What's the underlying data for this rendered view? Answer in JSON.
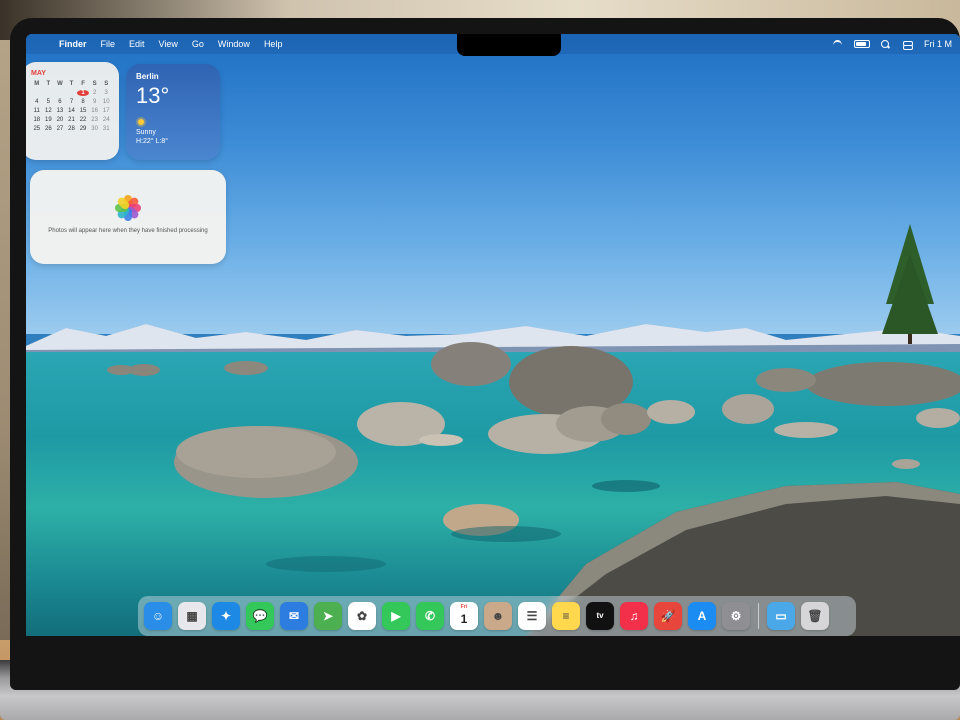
{
  "menubar": {
    "apple_glyph": "",
    "items": [
      "Finder",
      "File",
      "Edit",
      "View",
      "Go",
      "Window",
      "Help"
    ],
    "clock": "Fri 1 M"
  },
  "calendar_widget": {
    "month": "MAY",
    "weekdays": [
      "M",
      "T",
      "W",
      "T",
      "F",
      "S",
      "S"
    ],
    "weeks": [
      [
        "",
        "",
        "",
        "",
        "1",
        "2",
        "3"
      ],
      [
        "4",
        "5",
        "6",
        "7",
        "8",
        "9",
        "10"
      ],
      [
        "11",
        "12",
        "13",
        "14",
        "15",
        "16",
        "17"
      ],
      [
        "18",
        "19",
        "20",
        "21",
        "22",
        "23",
        "24"
      ],
      [
        "25",
        "26",
        "27",
        "28",
        "29",
        "30",
        "31"
      ]
    ],
    "today": "1"
  },
  "weather_widget": {
    "city": "Berlin",
    "temperature": "13°",
    "condition": "Sunny",
    "high_low": "H:22° L:8°",
    "icon": "sun-icon"
  },
  "photos_widget": {
    "message": "Photos will appear here when they have finished processing",
    "icon": "photos-icon"
  },
  "dock": {
    "apps": [
      {
        "name": "finder-app",
        "color": "#2a8ee8",
        "glyph": "☺"
      },
      {
        "name": "launchpad-app",
        "color": "#e8e8ec",
        "glyph": "▦"
      },
      {
        "name": "safari-app",
        "color": "#1e88e5",
        "glyph": "✦"
      },
      {
        "name": "messages-app",
        "color": "#34c759",
        "glyph": "💬"
      },
      {
        "name": "mail-app",
        "color": "#2d7ce0",
        "glyph": "✉"
      },
      {
        "name": "maps-app",
        "color": "#4caf50",
        "glyph": "➤"
      },
      {
        "name": "photos-app",
        "color": "#ffffff",
        "glyph": "✿"
      },
      {
        "name": "facetime-app",
        "color": "#34c759",
        "glyph": "▶"
      },
      {
        "name": "phone-app",
        "color": "#34c759",
        "glyph": "✆"
      },
      {
        "name": "calendar-app",
        "color": "#ffffff",
        "glyph": "1",
        "month": "Fri"
      },
      {
        "name": "contacts-app",
        "color": "#c9a98a",
        "glyph": "☻"
      },
      {
        "name": "reminders-app",
        "color": "#ffffff",
        "glyph": "☰"
      },
      {
        "name": "notes-app",
        "color": "#ffd84d",
        "glyph": "≡"
      },
      {
        "name": "tv-app",
        "color": "#111111",
        "glyph": "tv"
      },
      {
        "name": "music-app",
        "color": "#f3304a",
        "glyph": "♫"
      },
      {
        "name": "rocket-app",
        "color": "#e8453c",
        "glyph": "🚀"
      },
      {
        "name": "app-store-app",
        "color": "#1b8cf2",
        "glyph": "A"
      },
      {
        "name": "system-settings-app",
        "color": "#8e8e93",
        "glyph": "⚙"
      }
    ],
    "right": [
      {
        "name": "downloads-folder",
        "color": "#4aa8e8",
        "glyph": "▭"
      },
      {
        "name": "trash-app",
        "color": "#d6d6d8",
        "glyph": "🗑"
      }
    ]
  },
  "colors": {
    "accent_red": "#e0403a",
    "sky_top": "#1f6fc4",
    "lake": "#2aa6b4"
  }
}
